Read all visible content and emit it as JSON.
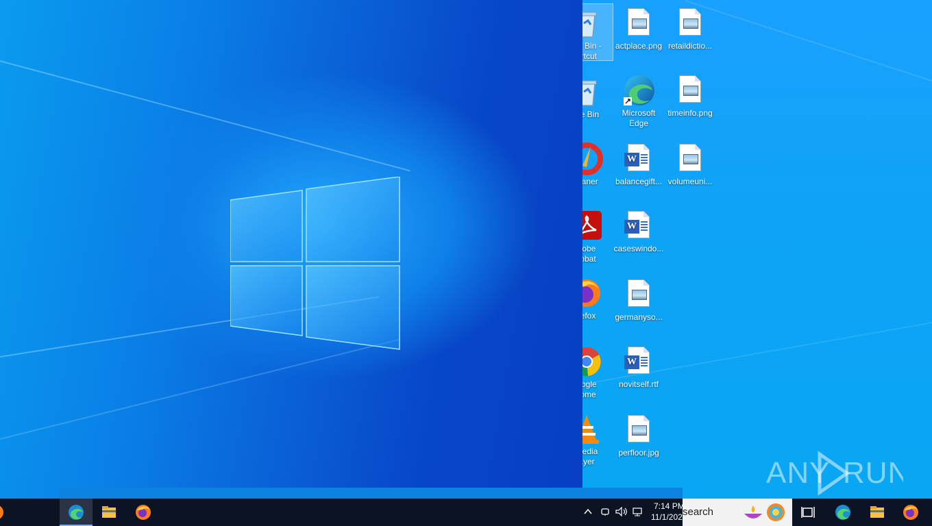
{
  "desktop_icons_partial": [
    {
      "label_line1": "cle Bin -",
      "label_line2": "ortcut",
      "icon": "recycle-bin-icon",
      "selected": true
    },
    {
      "label_line1": "cle Bin",
      "label_line2": "",
      "icon": "recycle-bin-icon"
    },
    {
      "label_line1": "leaner",
      "label_line2": "",
      "icon": "ccleaner-icon"
    },
    {
      "label_line1": "dobe",
      "label_line2": "robat",
      "icon": "adobe-acrobat-icon"
    },
    {
      "label_line1": "refox",
      "label_line2": "",
      "icon": "firefox-icon"
    },
    {
      "label_line1": "oogle",
      "label_line2": "rome",
      "icon": "chrome-icon"
    },
    {
      "label_line1": "media",
      "label_line2": "ayer",
      "icon": "vlc-icon"
    }
  ],
  "desktop_icons_col2": [
    {
      "label_line1": "actplace.png",
      "label_line2": "",
      "icon": "image-file-icon"
    },
    {
      "label_line1": "Microsoft",
      "label_line2": "Edge",
      "icon": "edge-icon"
    },
    {
      "label_line1": "balancegift...",
      "label_line2": "",
      "icon": "word-document-icon"
    },
    {
      "label_line1": "caseswindo...",
      "label_line2": "",
      "icon": "word-document-icon"
    },
    {
      "label_line1": "germanyso...",
      "label_line2": "",
      "icon": "image-file-icon"
    },
    {
      "label_line1": "novitself.rtf",
      "label_line2": "",
      "icon": "word-document-icon"
    },
    {
      "label_line1": "perfloor.jpg",
      "label_line2": "",
      "icon": "image-file-icon"
    }
  ],
  "desktop_icons_col3": [
    {
      "label_line1": "retaildictio...",
      "label_line2": "",
      "icon": "image-file-icon"
    },
    {
      "label_line1": "timeinfo.png",
      "label_line2": "",
      "icon": "image-file-icon"
    },
    {
      "label_line1": "volumeuni...",
      "label_line2": "",
      "icon": "image-file-icon"
    }
  ],
  "taskbar": {
    "time": "7:14 PM",
    "date": "11/1/202",
    "search_text": "search"
  },
  "watermark": "ANY RUN",
  "colors": {
    "accent": "#0a7ee6",
    "taskbar": "#0c1322"
  }
}
